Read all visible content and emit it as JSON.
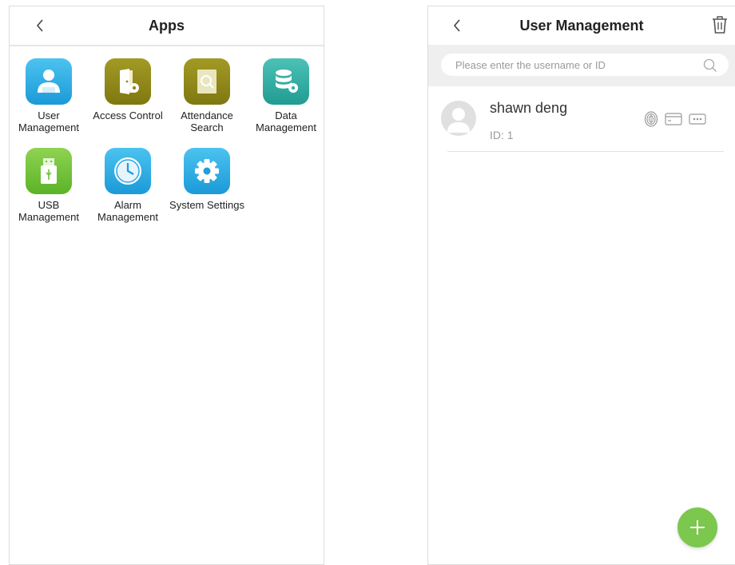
{
  "left_screen": {
    "title": "Apps",
    "apps": [
      {
        "label": "User Management",
        "icon": "user-icon",
        "color": "#29a6e2"
      },
      {
        "label": "Access Control",
        "icon": "door-gear-icon",
        "color": "#948b1a"
      },
      {
        "label": "Attendance Search",
        "icon": "document-search-icon",
        "color": "#948b1a"
      },
      {
        "label": "Data Management",
        "icon": "database-gear-icon",
        "color": "#35b0a5"
      },
      {
        "label": "USB Management",
        "icon": "usb-icon",
        "color": "#6fc23a"
      },
      {
        "label": "Alarm Management",
        "icon": "clock-icon",
        "color": "#29a6e2"
      },
      {
        "label": "System Settings",
        "icon": "gear-icon",
        "color": "#29a6e2"
      }
    ]
  },
  "right_screen": {
    "title": "User Management",
    "search": {
      "placeholder": "Please enter the username or ID",
      "value": ""
    },
    "users": [
      {
        "name": "shawn deng",
        "id_text": "ID: 1",
        "verify_icons": [
          "fingerprint-icon",
          "card-icon",
          "password-icon"
        ]
      }
    ],
    "fab_icon": "plus-icon",
    "fab_color": "#7cc74d"
  }
}
